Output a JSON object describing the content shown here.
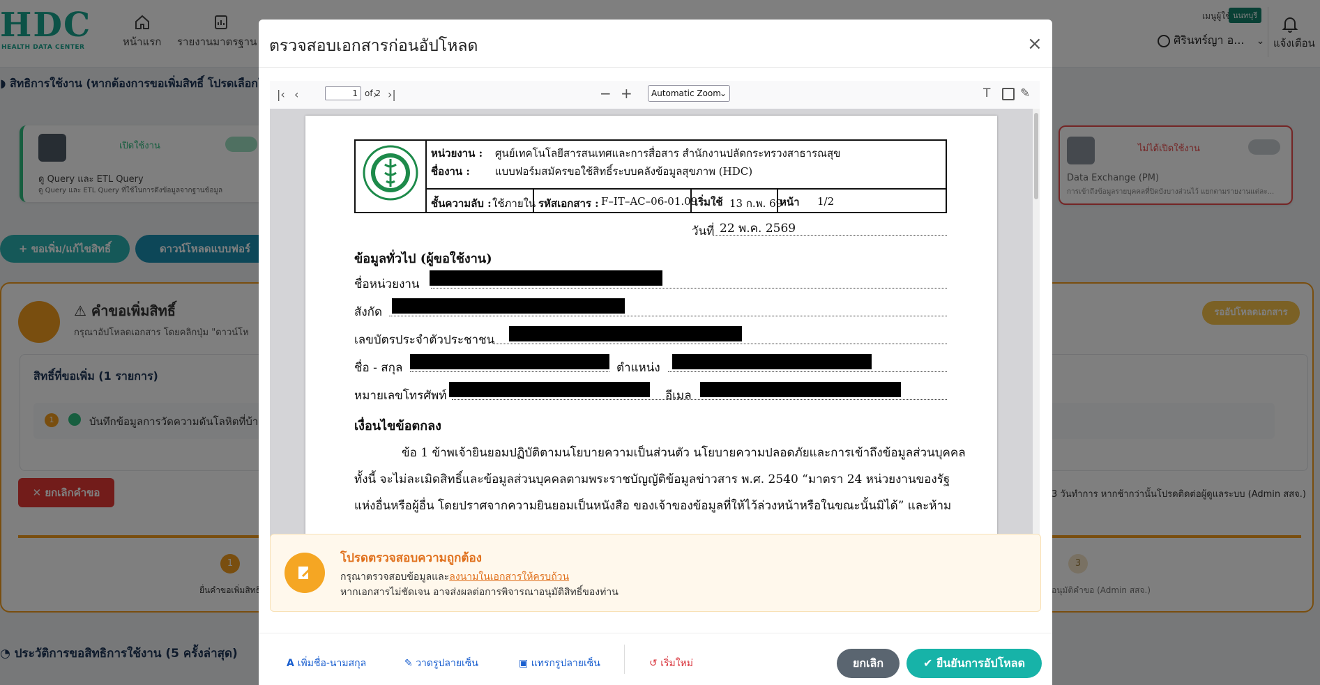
{
  "app": {
    "logo_text": "HDC",
    "logo_sub": "HEALTH DATA CENTER",
    "nav": [
      {
        "label": "หน้าแรก",
        "icon": "home-icon"
      },
      {
        "label": "รายงานมาตรฐาน ▾",
        "icon": "report-icon"
      }
    ],
    "user_menu_label": "เมนูผู้ใช้งาน",
    "province_badge": "นนทบุรี",
    "user_name": "ศิรินทร์ญา อ...",
    "notification_label": "แจ้งเตือน"
  },
  "background": {
    "permission_title": "สิทธิการใช้งาน (หากต้องการขอเพิ่มสิทธิ์ โปรดเลือกโดย",
    "card_left": {
      "status": "เปิดใช้งาน",
      "title": "ดู Query และ ETL Query",
      "desc": "ดู Query และ ETL Query ที่ใช้ในการดึงข้อมูลจากฐานข้อมูล"
    },
    "card_right": {
      "status": "ไม่ได้เปิดใช้งาน",
      "title": "Data Exchange (PM)",
      "desc": "การเข้าถึงข้อมูลรายบุคคลที่ปิดบังบางส่วนไว้ แยกตามรายงานแต่ละ..."
    },
    "add_button": "+ ขอเพิ่ม/แก้ไขสิทธิ์",
    "download_button": "ดาวน์โหลดแบบฟอร์",
    "request_title": "คำขอเพิ่มสิทธิ์",
    "request_sub": "กรุณาอัปโหลดเอกสาร โดยคลิกปุ่ม \"ดาวน์โห",
    "wait_badge": "รออัปโหลดเอกสาร",
    "requested_title": "สิทธิ์ที่ขอเพิ่ม (1 รายการ)",
    "requested_item_num": "1",
    "requested_item": "บันทึกข้อมูลการวัดความดันโลหิตที่บ้าน",
    "cancel_request": "ยกเลิกคำขอ",
    "right_note": "3 วันทำการ หากช้ากว่านั้นโปรดติดต่อผู้ดูแลระบบ (Admin สสจ.)",
    "step1_num": "1",
    "step1_label": "ยื่นคำขอเพิ่มสิทธิ์",
    "step3_num": "3",
    "step3_label": "อนุมัติคำขอ (Admin สสจ.)",
    "history_title": "ประวัติการขอสิทธิการใช้งาน (5 ครั้งล่าสุด)"
  },
  "modal": {
    "title": "ตรวจสอบเอกสารก่อนอัปโหลด",
    "close": "×",
    "pdf_toolbar": {
      "page_number": "1",
      "page_of": "of 2",
      "zoom": "Automatic Zoom"
    },
    "document": {
      "agency_label": "หน่วยงาน :",
      "agency_value": "ศูนย์เทคโนโลยีสารสนเทศและการสื่อสาร สำนักงานปลัดกระทรวงสาธารณสุข",
      "work_label": "ชื่องาน :",
      "work_value": "แบบฟอร์มสมัครขอใช้สิทธิ์ระบบคลังข้อมูลสุขภาพ (HDC)",
      "secret_label": "ชั้นความลับ :",
      "secret_value": "ใช้ภายใน",
      "code_label": "รหัสเอกสาร :",
      "code_value": "F–IT–AC–06-01.09",
      "start_label": "เริ่มใช้",
      "start_value": "13 ก.พ. 69",
      "page_label": "หน้า",
      "page_value": "1/2",
      "date_label": "วันที่",
      "date_value": "22 พ.ค. 2569",
      "section_general": "ข้อมูลทั่วไป (ผู้ขอใช้งาน)",
      "field_unit": "ชื่อหน่วยงาน",
      "field_affil": "สังกัด",
      "field_id": "เลขบัตรประจำตัวประชาชน",
      "field_name": "ชื่อ - สกุล",
      "field_position": "ตำแหน่ง",
      "field_phone": "หมายเลขโทรศัพท์",
      "field_email": "อีเมล",
      "section_terms": "เงื่อนไขข้อตกลง",
      "para_1": "ข้อ 1 ข้าพเจ้ายินยอมปฏิบัติตามนโยบายความเป็นส่วนตัว นโยบายความปลอดภัยและการเข้าถึงข้อมูลส่วนบุคคล",
      "para_2": "ทั้งนี้ จะไม่ละเมิดสิทธิ์และข้อมูลส่วนบุคคลตามพระราชบัญญัติข้อมูลข่าวสาร พ.ศ. 2540  “มาตรา 24 หน่วยงานของรัฐ",
      "para_3": "แห่งอื่นหรือผู้อื่น  โดยปราศจากความยินยอมเป็นหนังสือ  ของเจ้าของข้อมูลที่ให้ไว้ล่วงหน้าหรือในขณะนั้นมิได้”  และห้าม"
    },
    "notice": {
      "title": "โปรดตรวจสอบความถูกต้อง",
      "line1_prefix": "กรุณาตรวจสอบข้อมูลและ",
      "line1_link": "ลงนามในเอกสารให้ครบถ้วน",
      "line2": "หากเอกสารไม่ชัดเจน อาจส่งผลต่อการพิจารณาอนุมัติสิทธิ์ของท่าน"
    },
    "footer": {
      "add_name": "เพิ่มชื่อ-นามสกุล",
      "draw_sign": "วาดรูปลายเซ็น",
      "insert_sign": "แทรกรูปลายเซ็น",
      "reset": "เริ่มใหม่",
      "cancel": "ยกเลิก",
      "confirm": "ยืนยันการอัปโหลด"
    }
  }
}
